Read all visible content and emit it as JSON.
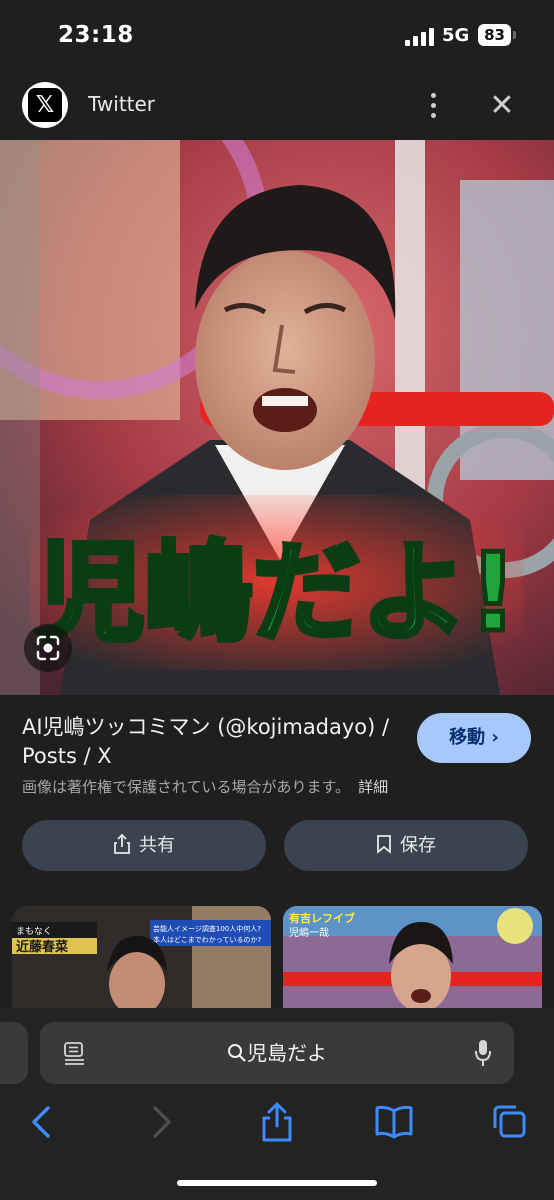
{
  "status": {
    "time": "23:18",
    "network": "5G",
    "battery": "83"
  },
  "header": {
    "site": "Twitter",
    "logo_text": "𝕏"
  },
  "image": {
    "caption": "児嶋だよ!"
  },
  "result": {
    "title": "AI児嶋ツッコミマン (@kojimadayo) / Posts / X",
    "visit_label": "移動 ›",
    "copyright": "画像は著作権で保護されている場合があります。",
    "detail": "詳細"
  },
  "actions": {
    "share": "共有",
    "save": "保存"
  },
  "thumbnails": [
    {
      "tag": "まもなく",
      "name": "近藤春菜",
      "banner": "芸能人イメージ調査100人中何人?",
      "sub": "本人はどこまでわかっているのか?"
    },
    {
      "tag": "有吉レフイブ",
      "name": "児嶋一哉"
    }
  ],
  "browser": {
    "search_text": "児島だよ"
  }
}
